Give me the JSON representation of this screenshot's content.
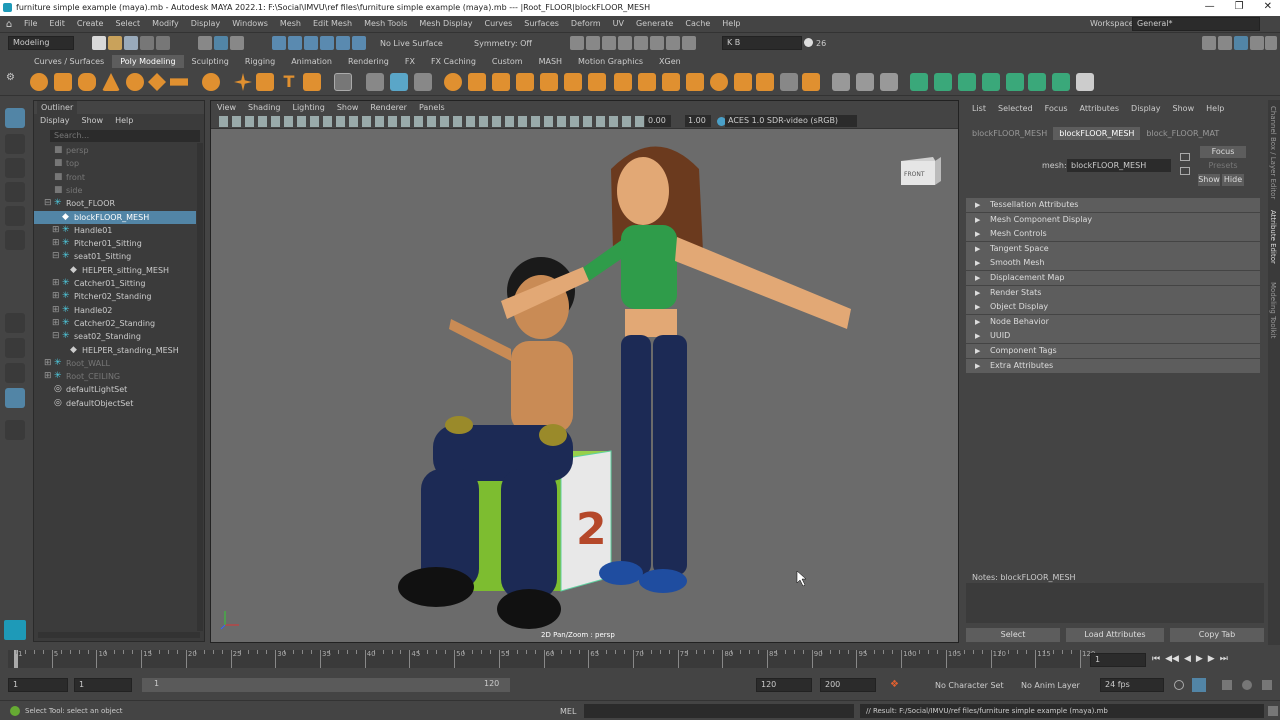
{
  "titlebar": {
    "title": "furniture simple example (maya).mb - Autodesk MAYA 2022.1: F:\\Social\\IMVU\\ref files\\furniture simple example (maya).mb  ---  |Root_FLOOR|blockFLOOR_MESH"
  },
  "menu": [
    "File",
    "Edit",
    "Create",
    "Select",
    "Modify",
    "Display",
    "Windows",
    "Mesh",
    "Edit Mesh",
    "Mesh Tools",
    "Mesh Display",
    "Curves",
    "Surfaces",
    "Deform",
    "UV",
    "Generate",
    "Cache",
    "Help"
  ],
  "workspace": {
    "label": "Workspace:",
    "value": "General*"
  },
  "status": {
    "mode": "Modeling",
    "live_surface": "No Live Surface",
    "symmetry": "Symmetry: Off",
    "user": "K B",
    "counter": "26"
  },
  "shelf_tabs": [
    "Curves / Surfaces",
    "Poly Modeling",
    "Sculpting",
    "Rigging",
    "Animation",
    "Rendering",
    "FX",
    "FX Caching",
    "Custom",
    "MASH",
    "Motion Graphics",
    "XGen"
  ],
  "shelf_active": "Poly Modeling",
  "outliner": {
    "tab": "Outliner",
    "menu": [
      "Display",
      "Show",
      "Help"
    ],
    "search_placeholder": "Search...",
    "items": [
      {
        "label": "persp",
        "depth": 1,
        "kind": "camera",
        "dim": true
      },
      {
        "label": "top",
        "depth": 1,
        "kind": "camera",
        "dim": true
      },
      {
        "label": "front",
        "depth": 1,
        "kind": "camera",
        "dim": true
      },
      {
        "label": "side",
        "depth": 1,
        "kind": "camera",
        "dim": true
      },
      {
        "label": "Root_FLOOR",
        "depth": 1,
        "kind": "joint",
        "expand": "-"
      },
      {
        "label": "blockFLOOR_MESH",
        "depth": 2,
        "kind": "mesh",
        "selected": true
      },
      {
        "label": "Handle01",
        "depth": 2,
        "kind": "joint",
        "expand": "+"
      },
      {
        "label": "Pitcher01_Sitting",
        "depth": 2,
        "kind": "joint",
        "expand": "+"
      },
      {
        "label": "seat01_Sitting",
        "depth": 2,
        "kind": "joint",
        "expand": "-"
      },
      {
        "label": "HELPER_sitting_MESH",
        "depth": 3,
        "kind": "mesh"
      },
      {
        "label": "Catcher01_Sitting",
        "depth": 2,
        "kind": "joint",
        "expand": "+"
      },
      {
        "label": "Pitcher02_Standing",
        "depth": 2,
        "kind": "joint",
        "expand": "+"
      },
      {
        "label": "Handle02",
        "depth": 2,
        "kind": "joint",
        "expand": "+"
      },
      {
        "label": "Catcher02_Standing",
        "depth": 2,
        "kind": "joint",
        "expand": "+"
      },
      {
        "label": "seat02_Standing",
        "depth": 2,
        "kind": "joint",
        "expand": "-"
      },
      {
        "label": "HELPER_standing_MESH",
        "depth": 3,
        "kind": "mesh"
      },
      {
        "label": "Root_WALL",
        "depth": 1,
        "kind": "joint",
        "expand": "+",
        "dim": true
      },
      {
        "label": "Root_CEILING",
        "depth": 1,
        "kind": "joint",
        "expand": "+",
        "dim": true
      },
      {
        "label": "defaultLightSet",
        "depth": 1,
        "kind": "set"
      },
      {
        "label": "defaultObjectSet",
        "depth": 1,
        "kind": "set"
      }
    ]
  },
  "viewport": {
    "menu": [
      "View",
      "Shading",
      "Lighting",
      "Show",
      "Renderer",
      "Panels"
    ],
    "near": "0.00",
    "far": "1.00",
    "colorspace": "ACES 1.0 SDR-video (sRGB)",
    "cube_label": "FRONT",
    "hud": "2D Pan/Zoom : persp",
    "crate_number": "2"
  },
  "attr": {
    "menu": [
      "List",
      "Selected",
      "Focus",
      "Attributes",
      "Display",
      "Show",
      "Help"
    ],
    "node_tabs": [
      "blockFLOOR_MESH",
      "blockFLOOR_MESH",
      "block_FLOOR_MAT"
    ],
    "active_tab": 1,
    "mesh_label": "mesh:",
    "mesh_value": "blockFLOOR_MESH",
    "focus": "Focus",
    "presets": "Presets",
    "show": "Show",
    "hide": "Hide",
    "sections": [
      "Tessellation Attributes",
      "Mesh Component Display",
      "Mesh Controls",
      "Tangent Space",
      "Smooth Mesh",
      "Displacement Map",
      "Render Stats",
      "Object Display",
      "Node Behavior",
      "UUID",
      "Component Tags",
      "Extra Attributes"
    ],
    "notes": "Notes:  blockFLOOR_MESH",
    "buttons": [
      "Select",
      "Load Attributes",
      "Copy Tab"
    ]
  },
  "right_tabs": [
    "Channel Box / Layer Editor",
    "Attribute Editor",
    "Modeling Toolkit"
  ],
  "timeline": {
    "ticks": [
      "1",
      "5",
      "10",
      "15",
      "20",
      "25",
      "30",
      "35",
      "40",
      "45",
      "50",
      "55",
      "60",
      "65",
      "70",
      "75",
      "80",
      "85",
      "90",
      "95",
      "100",
      "105",
      "110",
      "115",
      "120"
    ],
    "current": "1"
  },
  "range": {
    "start": "1",
    "start2": "1",
    "slider_start": "1",
    "slider_end": "120",
    "end": "120",
    "end2": "200",
    "char_set": "No Character Set",
    "anim_layer": "No Anim Layer",
    "fps": "24 fps"
  },
  "cmd": {
    "help": "Select Tool: select an object",
    "lang": "MEL",
    "result": "// Result: F:/Social/IMVU/ref files/furniture simple example (maya).mb"
  }
}
